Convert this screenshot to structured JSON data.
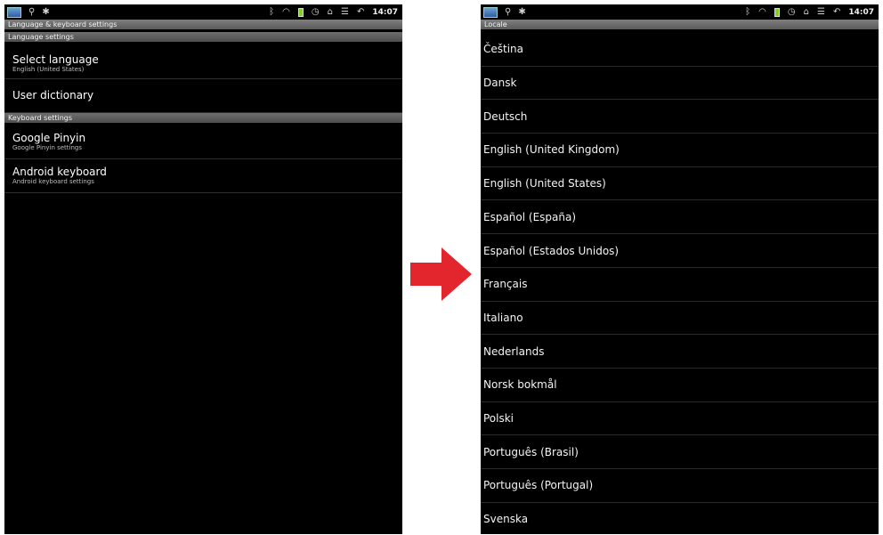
{
  "status_bar": {
    "time": "14:07",
    "icons": [
      "screenshot-thumb-icon",
      "usb-icon",
      "android-debug-icon",
      "bluetooth-icon",
      "wifi-icon",
      "battery-icon",
      "alarm-icon",
      "home-icon",
      "menu-icon",
      "back-icon"
    ]
  },
  "left_screen": {
    "title": "Language & keyboard settings",
    "sections": [
      {
        "header": "Language settings",
        "items": [
          {
            "title": "Select language",
            "subtitle": "English (United States)"
          },
          {
            "title": "User dictionary",
            "subtitle": ""
          }
        ]
      },
      {
        "header": "Keyboard settings",
        "items": [
          {
            "title": "Google Pinyin",
            "subtitle": "Google Pinyin settings"
          },
          {
            "title": "Android keyboard",
            "subtitle": "Android keyboard settings"
          }
        ]
      }
    ]
  },
  "right_screen": {
    "title": "Locale",
    "locales": [
      "Čeština",
      "Dansk",
      "Deutsch",
      "English (United Kingdom)",
      "English (United States)",
      "Español (España)",
      "Español (Estados Unidos)",
      "Français",
      "Italiano",
      "Nederlands",
      "Norsk bokmål",
      "Polski",
      "Português (Brasil)",
      "Português (Portugal)",
      "Svenska"
    ]
  },
  "colors": {
    "arrow": "#e3262d",
    "screen_bg": "#000000",
    "header_bg": "#5e5e5e"
  }
}
